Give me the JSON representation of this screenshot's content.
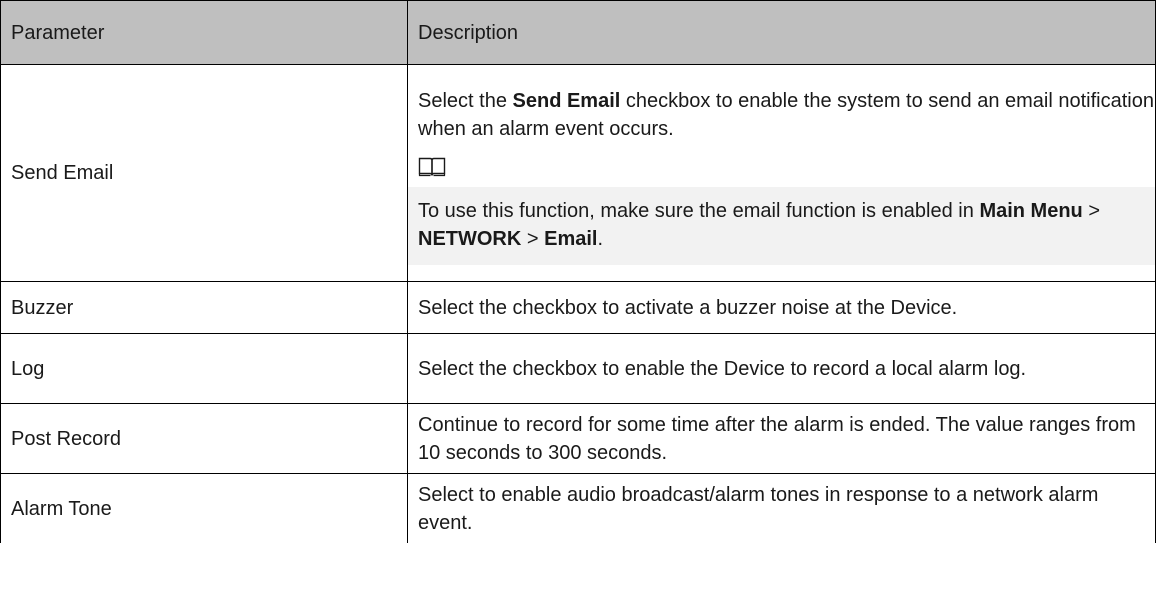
{
  "table": {
    "headers": {
      "parameter": "Parameter",
      "description": "Description"
    },
    "rows": {
      "send_email": {
        "parameter": "Send Email",
        "desc_pre": "Select the ",
        "desc_bold": "Send Email",
        "desc_post": "  checkbox to enable the system to send an email notification when an alarm event occurs.",
        "note_icon": "book-icon",
        "note_pre": "To use this function, make sure the email function is enabled in ",
        "note_menu": "Main Menu",
        "note_sep1": "  > ",
        "note_network": "NETWORK",
        "note_sep2": " > ",
        "note_email": "Email",
        "note_end": "."
      },
      "buzzer": {
        "parameter": "Buzzer",
        "description": "Select the checkbox to activate a buzzer noise at the Device."
      },
      "log": {
        "parameter": "Log",
        "description": "Select the checkbox to enable the Device to record a local alarm log."
      },
      "post_record": {
        "parameter": "Post Record",
        "description": "Continue to record for some time after the alarm is ended. The value ranges from 10 seconds to 300 seconds."
      },
      "alarm_tone": {
        "parameter": "Alarm Tone",
        "description": "Select to enable audio broadcast/alarm tones in response to a network alarm event."
      }
    }
  }
}
